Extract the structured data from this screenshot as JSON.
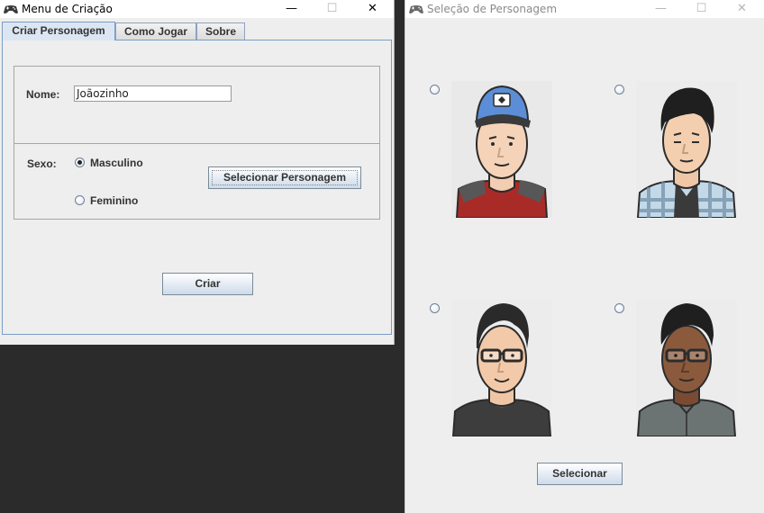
{
  "window1": {
    "title": "Menu de Criação",
    "tabs": [
      {
        "label": "Criar Personagem",
        "active": true
      },
      {
        "label": "Como Jogar",
        "active": false
      },
      {
        "label": "Sobre",
        "active": false
      }
    ],
    "name_label": "Nome:",
    "name_value": "Joãozinho",
    "sex_label": "Sexo:",
    "sex_options": [
      {
        "label": "Masculino",
        "selected": true
      },
      {
        "label": "Feminino",
        "selected": false
      }
    ],
    "select_character_button": "Selecionar Personagem",
    "create_button": "Criar"
  },
  "window2": {
    "title": "Seleção de Personagem",
    "avatars": [
      {
        "name": "avatar-cap-guy-icon",
        "selected": false
      },
      {
        "name": "avatar-plaid-shirt-icon",
        "selected": false
      },
      {
        "name": "avatar-glasses-guy-icon",
        "selected": false
      },
      {
        "name": "avatar-glasses-dark-skin-icon",
        "selected": false
      }
    ],
    "select_button": "Selecionar"
  },
  "controls": {
    "minimize": "—",
    "maximize": "☐",
    "close": "✕"
  },
  "colors": {
    "tab_active": "#dce6f3",
    "tab_border": "#7a9cc6",
    "window_bg": "#eeeeee",
    "desktop_bg": "#2b2b2b"
  }
}
